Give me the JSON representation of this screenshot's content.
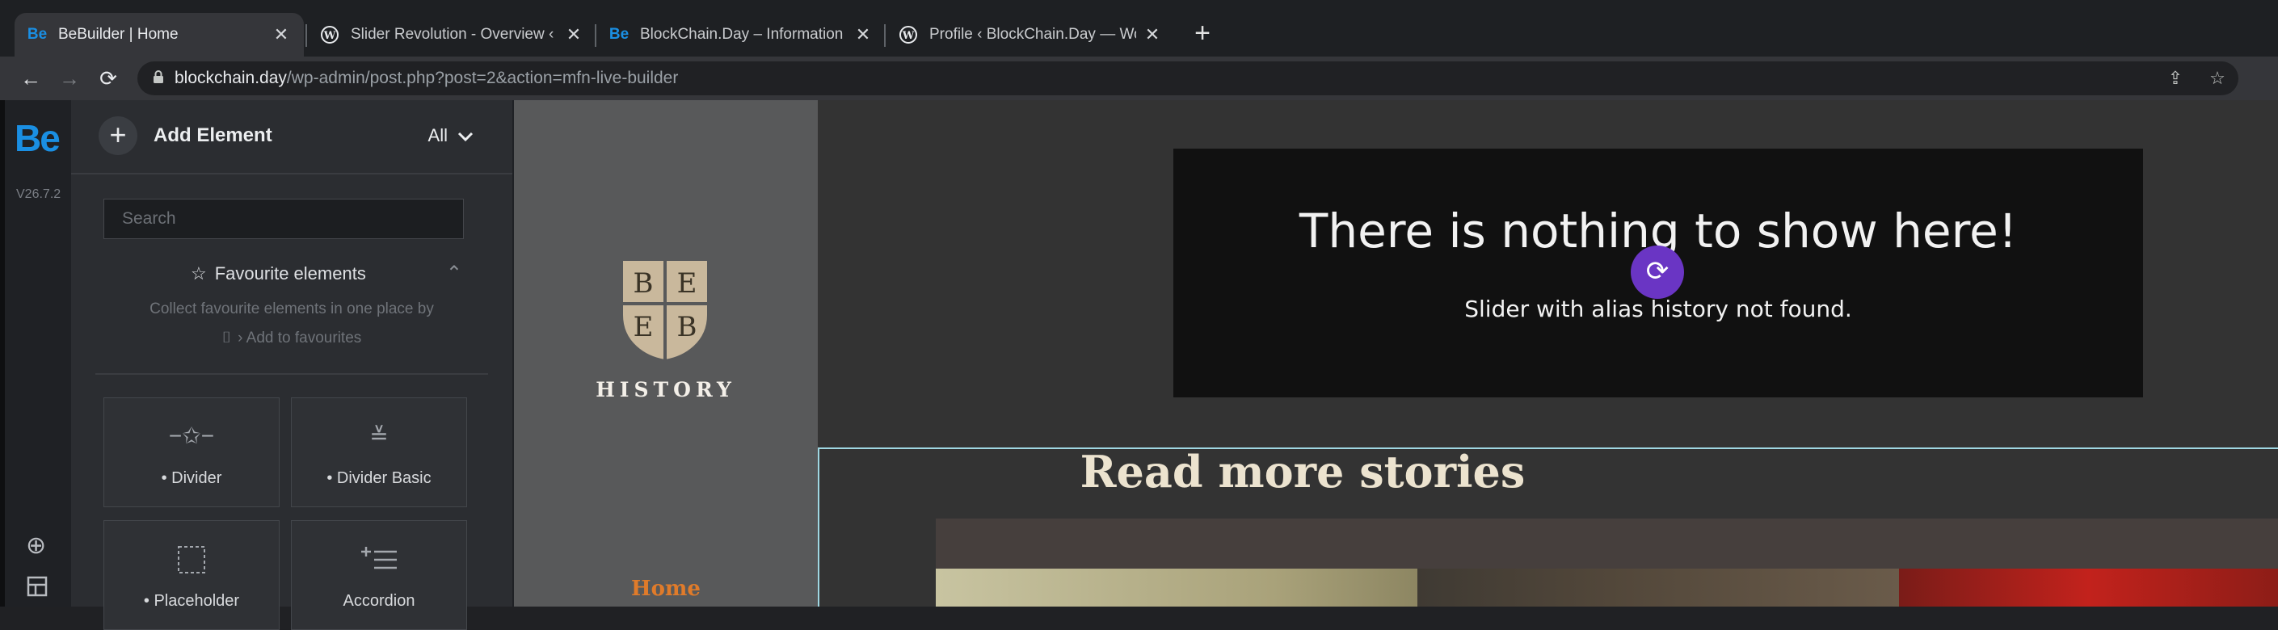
{
  "browser": {
    "tabs": [
      {
        "title": "BeBuilder | Home",
        "favicon": "bebuilder",
        "active": true
      },
      {
        "title": "Slider Revolution - Overview ‹ B",
        "favicon": "wordpress",
        "active": false
      },
      {
        "title": "BlockChain.Day – Information ar",
        "favicon": "bebuilder",
        "active": false
      },
      {
        "title": "Profile ‹ BlockChain.Day — Wor",
        "favicon": "wordpress",
        "active": false
      }
    ],
    "url_host": "blockchain.day",
    "url_path": "/wp-admin/post.php?post=2&action=mfn-live-builder"
  },
  "sidebar": {
    "logo": "Be",
    "version": "V26.7.2"
  },
  "panel": {
    "title": "Add Element",
    "filter": "All",
    "search_placeholder": "Search",
    "favourites": {
      "title": "Favourite elements",
      "desc_line1": "Collect favourite elements in one place by",
      "desc_line2": "› Add to favourites"
    },
    "elements": [
      {
        "label": "• Divider",
        "icon": "divider-icon"
      },
      {
        "label": "• Divider Basic",
        "icon": "divider-basic-icon"
      },
      {
        "label": "• Placeholder",
        "icon": "placeholder-icon"
      },
      {
        "label": "Accordion",
        "icon": "accordion-icon"
      }
    ]
  },
  "preview": {
    "logo_letters": [
      "B",
      "E",
      "E",
      "B"
    ],
    "logo_word": "HISTORY",
    "nav_home": "Home",
    "slider_title": "There is nothing to show here!",
    "slider_subtitle": "Slider with alias history not found.",
    "section_title": "Read more stories"
  },
  "colors": {
    "accent_be": "#1a8fe3",
    "home_link": "#e07b2a",
    "refresh_button": "#6a35c4",
    "section_title": "#ece3cf"
  }
}
